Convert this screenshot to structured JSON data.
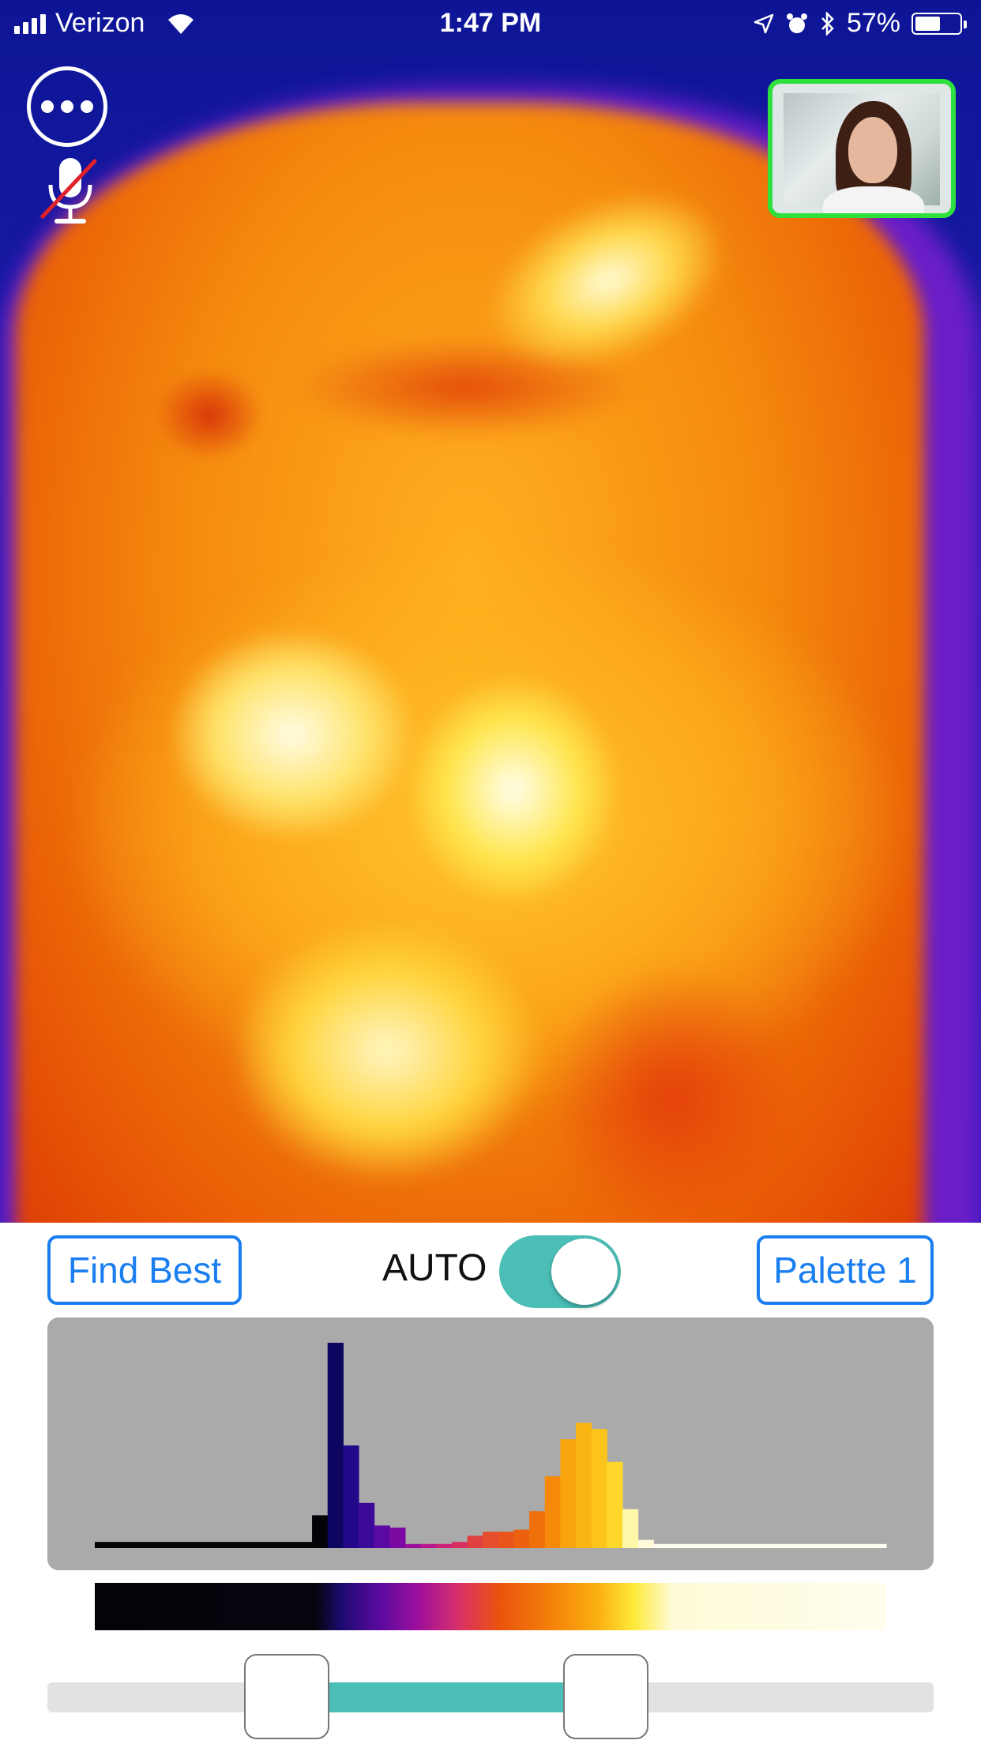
{
  "status_bar": {
    "carrier": "Verizon",
    "time": "1:47 PM",
    "battery": "57%",
    "battery_level": 0.57,
    "icons": [
      "signal-bars-icon",
      "wifi-icon",
      "location-arrow-icon",
      "alarm-icon",
      "bluetooth-icon",
      "battery-icon"
    ]
  },
  "overlay": {
    "more_button_icon": "ellipsis-icon",
    "mic_button_icon": "microphone-muted-icon",
    "mic_muted": true,
    "pip_border_color": "#2ee03e"
  },
  "controls": {
    "find_best_label": "Find Best",
    "auto_label": "AUTO",
    "auto_enabled": true,
    "palette_label": "Palette 1",
    "accent_color": "#1a7ef0",
    "toggle_color": "#4bbfb6"
  },
  "histogram": {
    "background": "#aaaaaa",
    "bars": [
      {
        "h": 3,
        "c": "#050308"
      },
      {
        "h": 3,
        "c": "#050308"
      },
      {
        "h": 3,
        "c": "#050308"
      },
      {
        "h": 3,
        "c": "#050308"
      },
      {
        "h": 3,
        "c": "#050308"
      },
      {
        "h": 3,
        "c": "#050308"
      },
      {
        "h": 3,
        "c": "#050308"
      },
      {
        "h": 3,
        "c": "#050308"
      },
      {
        "h": 3,
        "c": "#050308"
      },
      {
        "h": 3,
        "c": "#050308"
      },
      {
        "h": 3,
        "c": "#050308"
      },
      {
        "h": 3,
        "c": "#050308"
      },
      {
        "h": 3,
        "c": "#050308"
      },
      {
        "h": 3,
        "c": "#050308"
      },
      {
        "h": 16,
        "c": "#050308"
      },
      {
        "h": 100,
        "c": "#0c0660"
      },
      {
        "h": 50,
        "c": "#24088a"
      },
      {
        "h": 22,
        "c": "#3c0a98"
      },
      {
        "h": 11,
        "c": "#5a0aa0"
      },
      {
        "h": 10,
        "c": "#7a0aa2"
      },
      {
        "h": 2,
        "c": "#9a0e9c"
      },
      {
        "h": 2,
        "c": "#b8158e"
      },
      {
        "h": 2,
        "c": "#cc2278"
      },
      {
        "h": 3,
        "c": "#d83060"
      },
      {
        "h": 6,
        "c": "#e14040"
      },
      {
        "h": 8,
        "c": "#e54e2c"
      },
      {
        "h": 8,
        "c": "#e8541c"
      },
      {
        "h": 9,
        "c": "#ec6010"
      },
      {
        "h": 18,
        "c": "#f0700c"
      },
      {
        "h": 35,
        "c": "#f58a0a"
      },
      {
        "h": 53,
        "c": "#f9a40c"
      },
      {
        "h": 61,
        "c": "#fbb513"
      },
      {
        "h": 58,
        "c": "#fcc41a"
      },
      {
        "h": 42,
        "c": "#fdd82a"
      },
      {
        "h": 19,
        "c": "#fef6a8"
      },
      {
        "h": 4,
        "c": "#fffbd8"
      },
      {
        "h": 2,
        "c": "#fffdee"
      },
      {
        "h": 2,
        "c": "#fffdee"
      },
      {
        "h": 2,
        "c": "#fffdee"
      },
      {
        "h": 2,
        "c": "#fffdee"
      },
      {
        "h": 2,
        "c": "#fffdee"
      },
      {
        "h": 2,
        "c": "#fffdee"
      },
      {
        "h": 2,
        "c": "#fffdee"
      },
      {
        "h": 2,
        "c": "#fffdee"
      },
      {
        "h": 2,
        "c": "#fffdee"
      },
      {
        "h": 2,
        "c": "#fffdee"
      },
      {
        "h": 2,
        "c": "#fffdee"
      },
      {
        "h": 2,
        "c": "#fffdee"
      },
      {
        "h": 2,
        "c": "#fffdee"
      },
      {
        "h": 2,
        "c": "#fffdee"
      },
      {
        "h": 2,
        "c": "#fffdee"
      }
    ]
  },
  "range_slider": {
    "low": 0.27,
    "high": 0.63
  }
}
